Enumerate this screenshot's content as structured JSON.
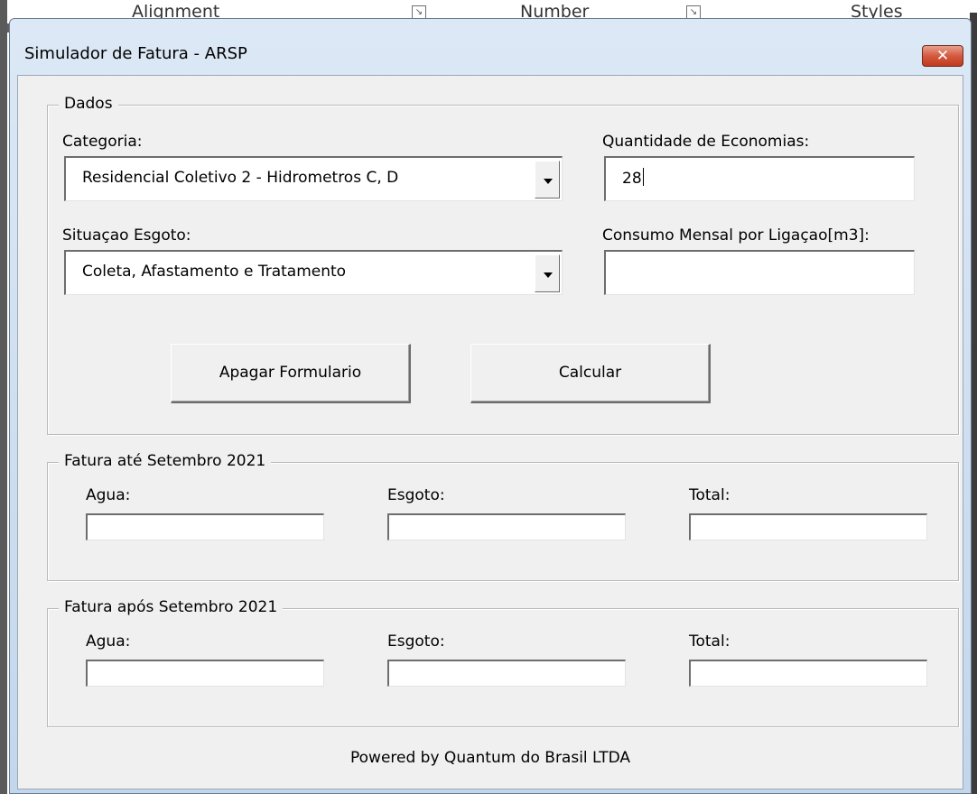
{
  "ribbon": {
    "groups": [
      "Alignment",
      "Number",
      "Styles"
    ]
  },
  "dialog": {
    "title": "Simulador de Fatura - ARSP",
    "close_icon": "close-x-icon",
    "dados": {
      "legend": "Dados",
      "categoria_label": "Categoria:",
      "categoria_value": "Residencial Coletivo 2 - Hidrometros C, D",
      "economias_label": "Quantidade de Economias:",
      "economias_value": "28",
      "esgoto_label": "Situaçao Esgoto:",
      "esgoto_value": "Coleta, Afastamento e Tratamento",
      "consumo_label": "Consumo Mensal por Ligaçao[m3]:",
      "consumo_value": "",
      "apagar_label": "Apagar Formulario",
      "calcular_label": "Calcular"
    },
    "fatura_ate": {
      "legend": "Fatura até Setembro 2021",
      "agua_label": "Agua:",
      "esgoto_label": "Esgoto:",
      "total_label": "Total:",
      "agua_value": "",
      "esgoto_value": "",
      "total_value": ""
    },
    "fatura_apos": {
      "legend": "Fatura após Setembro 2021",
      "agua_label": "Agua:",
      "esgoto_label": "Esgoto:",
      "total_label": "Total:",
      "agua_value": "",
      "esgoto_value": "",
      "total_value": ""
    },
    "footer": "Powered by Quantum do Brasil LTDA"
  },
  "colors": {
    "close_button": "#c8452a",
    "client_bg": "#f0f0f0",
    "title_gradient_top": "#dce8f5"
  }
}
